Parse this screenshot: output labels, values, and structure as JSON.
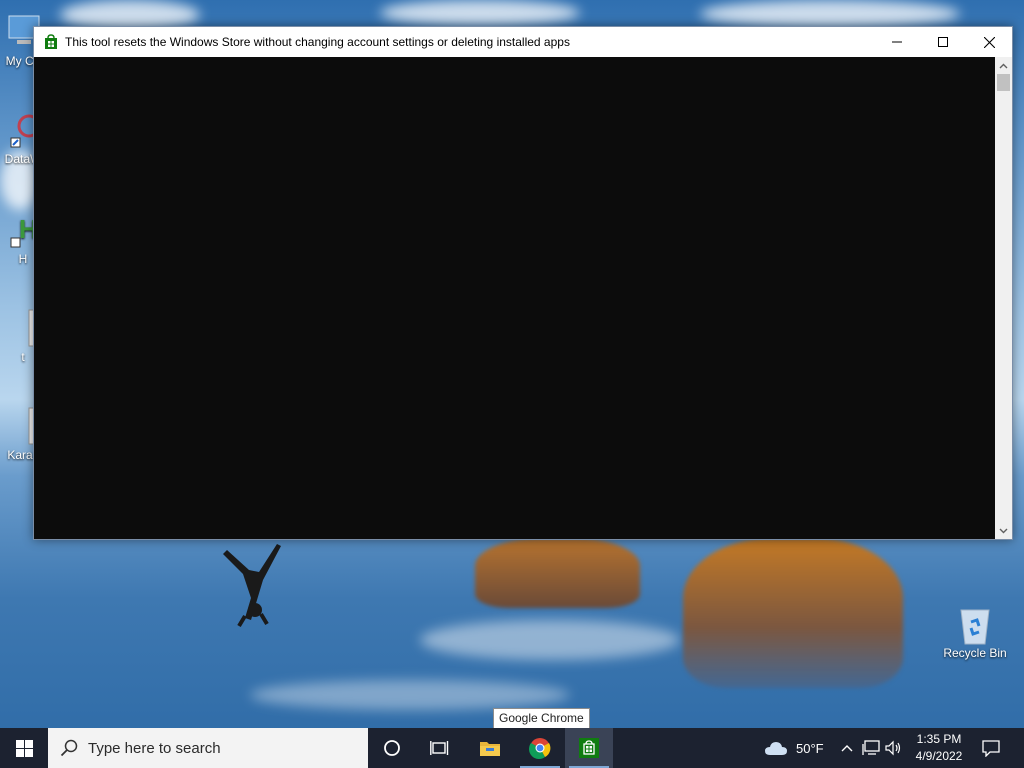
{
  "window": {
    "title": "This tool resets the Windows Store without changing account settings or deleting installed apps"
  },
  "desktop": {
    "icons": [
      {
        "label": "My Co"
      },
      {
        "label": "DataW"
      },
      {
        "label": "H"
      },
      {
        "label": "t"
      },
      {
        "label": "Karaz"
      },
      {
        "label": "Recycle Bin"
      }
    ]
  },
  "tooltip": {
    "text": "Google Chrome"
  },
  "taskbar": {
    "search_placeholder": "Type here to search",
    "weather": {
      "temp": "50°F",
      "icon": "cloud-icon"
    },
    "clock": {
      "time": "1:35 PM",
      "date": "4/9/2022"
    },
    "apps": [
      "task-view",
      "file-explorer",
      "google-chrome",
      "windows-store"
    ]
  },
  "colors": {
    "console_bg": "#0c0c0c",
    "taskbar_bg": "#1c2230",
    "store_green": "#107c10"
  }
}
